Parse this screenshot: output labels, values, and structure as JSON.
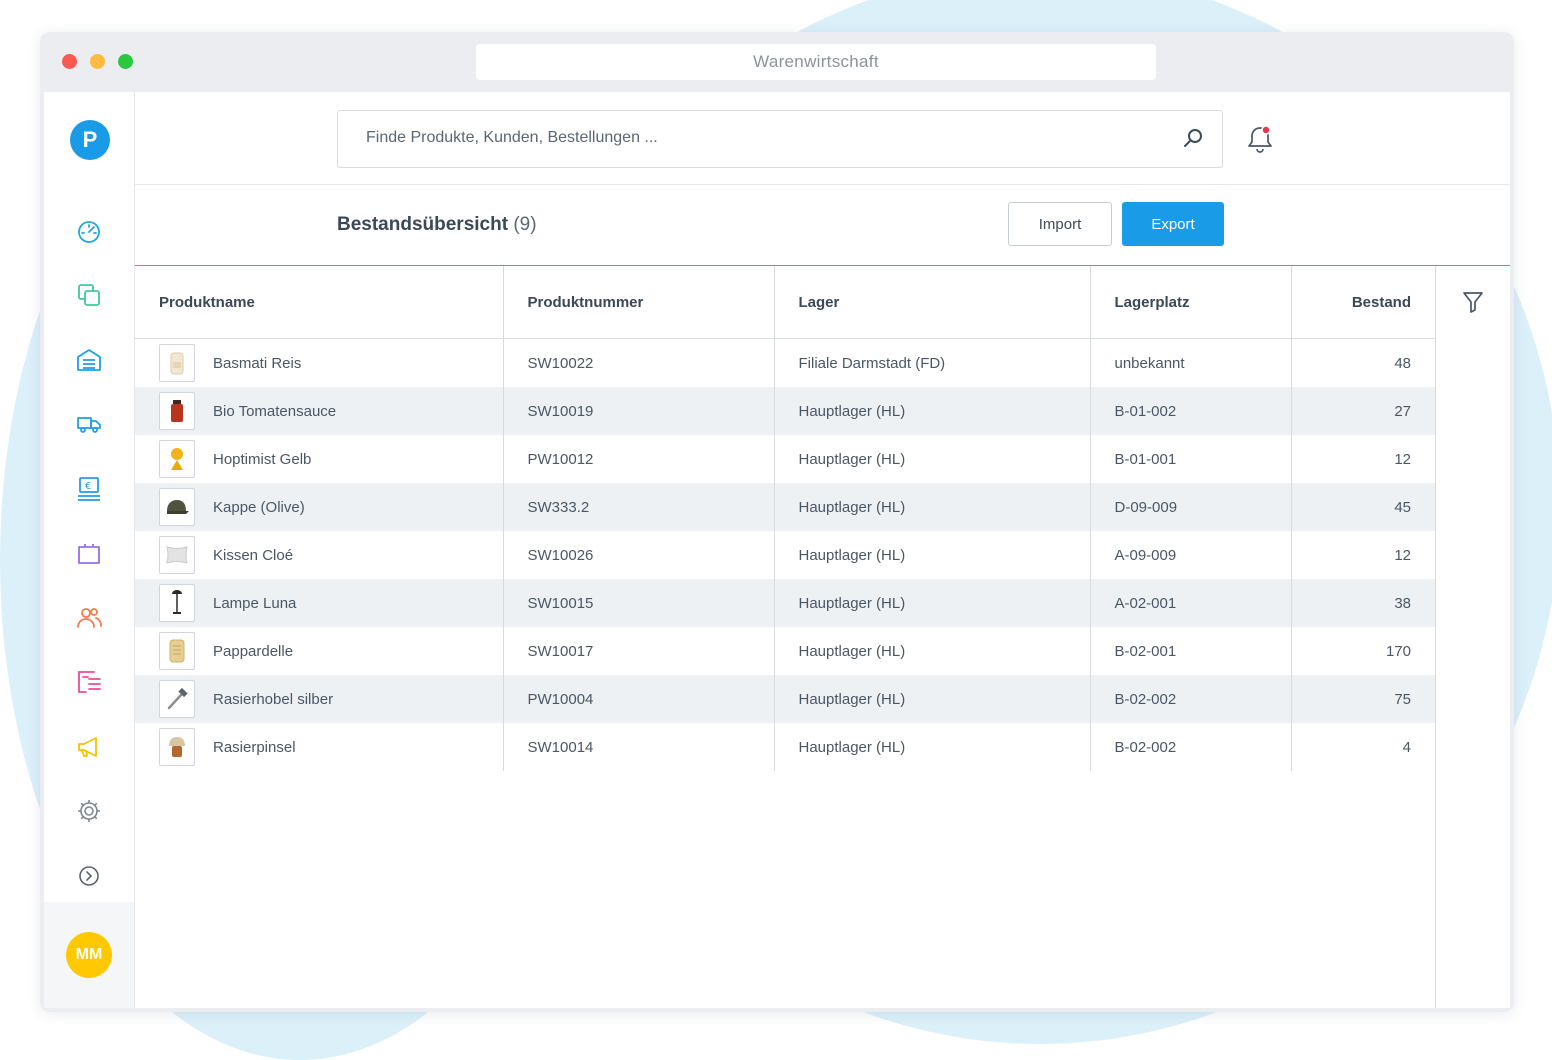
{
  "window": {
    "title": "Warenwirtschaft"
  },
  "sidebar": {
    "logo": "P",
    "items": [
      {
        "name": "dashboard",
        "icon": "gauge-icon",
        "color": "#22a9d6"
      },
      {
        "name": "products",
        "icon": "copy-icon",
        "color": "#3ec99a"
      },
      {
        "name": "warehouse",
        "icon": "warehouse-icon",
        "color": "#1e9fe8"
      },
      {
        "name": "shipping",
        "icon": "truck-icon",
        "color": "#1e9fe8"
      },
      {
        "name": "pos",
        "icon": "pos-terminal-icon",
        "color": "#1e9fe8"
      },
      {
        "name": "orders",
        "icon": "shopping-bag-icon",
        "color": "#9a6ee6"
      },
      {
        "name": "customers",
        "icon": "users-icon",
        "color": "#f47a4d"
      },
      {
        "name": "documents",
        "icon": "document-list-icon",
        "color": "#ea4c96"
      },
      {
        "name": "marketing",
        "icon": "megaphone-icon",
        "color": "#f5c400"
      },
      {
        "name": "settings",
        "icon": "gear-icon",
        "color": "#7d8790"
      },
      {
        "name": "expand",
        "icon": "chevron-right-circle-icon",
        "color": "#5a6570"
      }
    ],
    "avatar": {
      "initials": "MM",
      "color": "#ffc800"
    }
  },
  "search": {
    "placeholder": "Finde Produkte, Kunden, Bestellungen ...",
    "value": ""
  },
  "header": {
    "title": "Bestandsübersicht",
    "count": "(9)",
    "import_label": "Import",
    "export_label": "Export"
  },
  "table": {
    "columns": [
      "Produktname",
      "Produktnummer",
      "Lager",
      "Lagerplatz",
      "Bestand"
    ],
    "rows": [
      {
        "name": "Basmati Reis",
        "number": "SW10022",
        "lager": "Filiale Darmstadt (FD)",
        "platz": "unbekannt",
        "bestand": "48",
        "thumb": "rice-bag-icon"
      },
      {
        "name": "Bio Tomatensauce",
        "number": "SW10019",
        "lager": "Hauptlager (HL)",
        "platz": "B-01-002",
        "bestand": "27",
        "thumb": "sauce-jar-icon"
      },
      {
        "name": "Hoptimist Gelb",
        "number": "PW10012",
        "lager": "Hauptlager (HL)",
        "platz": "B-01-001",
        "bestand": "12",
        "thumb": "hoptimist-figure-icon"
      },
      {
        "name": "Kappe (Olive)",
        "number": "SW333.2",
        "lager": "Hauptlager (HL)",
        "platz": "D-09-009",
        "bestand": "45",
        "thumb": "cap-icon"
      },
      {
        "name": "Kissen Cloé",
        "number": "SW10026",
        "lager": "Hauptlager (HL)",
        "platz": "A-09-009",
        "bestand": "12",
        "thumb": "pillow-icon"
      },
      {
        "name": "Lampe Luna",
        "number": "SW10015",
        "lager": "Hauptlager (HL)",
        "platz": "A-02-001",
        "bestand": "38",
        "thumb": "lamp-icon"
      },
      {
        "name": "Pappardelle",
        "number": "SW10017",
        "lager": "Hauptlager (HL)",
        "platz": "B-02-001",
        "bestand": "170",
        "thumb": "pasta-bag-icon"
      },
      {
        "name": "Rasierhobel silber",
        "number": "PW10004",
        "lager": "Hauptlager (HL)",
        "platz": "B-02-002",
        "bestand": "75",
        "thumb": "razor-icon"
      },
      {
        "name": "Rasierpinsel",
        "number": "SW10014",
        "lager": "Hauptlager (HL)",
        "platz": "B-02-002",
        "bestand": "4",
        "thumb": "shaving-brush-icon"
      }
    ]
  },
  "colors": {
    "accent": "#1a9be8",
    "divider_teal": "#32b5b0",
    "row_alt": "#eef1f4",
    "notification_dot": "#e8344e"
  }
}
